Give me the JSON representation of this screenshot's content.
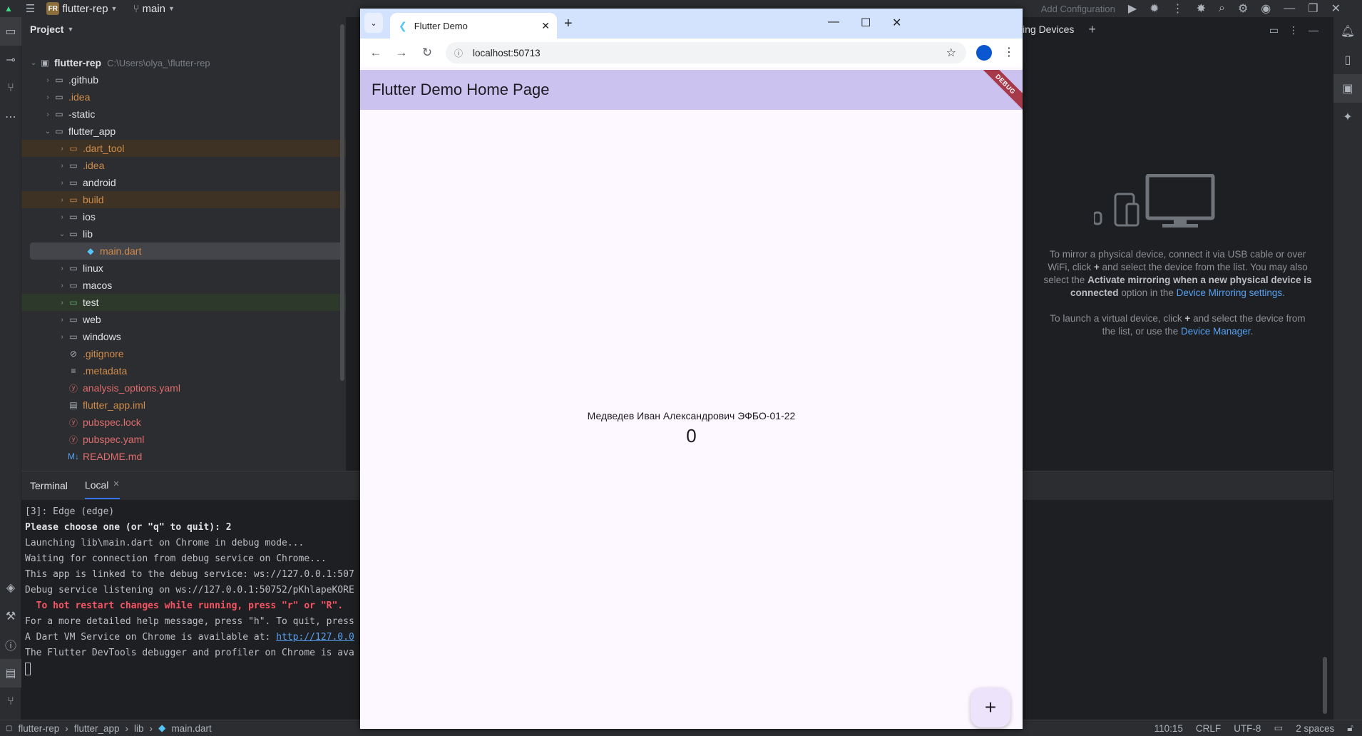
{
  "ide": {
    "project_badge": "FR",
    "project_name": "flutter-rep",
    "branch": "main",
    "run_config": "Add Configuration",
    "project_panel_title": "Project",
    "tree": {
      "root_name": "flutter-rep",
      "root_path": "C:\\Users\\olya_\\flutter-rep",
      "items": [
        ".github",
        ".idea",
        "-static",
        "flutter_app",
        ".dart_tool",
        ".idea",
        "android",
        "build",
        "ios",
        "lib",
        "main.dart",
        "linux",
        "macos",
        "test",
        "web",
        "windows",
        ".gitignore",
        ".metadata",
        "analysis_options.yaml",
        "flutter_app.iml",
        "pubspec.lock",
        "pubspec.yaml",
        "README.md"
      ]
    },
    "devices": {
      "title": "ing Devices",
      "mirror_text_1": "To mirror a physical device, connect it via USB cable or over",
      "mirror_text_2a": "WiFi, click",
      "mirror_text_2b": "and select the device from the list. You may also",
      "mirror_text_3a": "select the",
      "mirror_text_3b": "Activate mirroring when a new physical device is",
      "mirror_text_4a": "connected",
      "mirror_text_4b": "option in the",
      "mirror_link": "Device Mirroring settings",
      "virtual_text_1a": "To launch a virtual device, click",
      "virtual_text_1b": "and select the device from",
      "virtual_text_2": "the list, or use the",
      "virtual_link": "Device Manager"
    },
    "terminal": {
      "tab_terminal": "Terminal",
      "tab_local": "Local",
      "lines": [
        "[3]: Edge (edge)",
        "Please choose one (or \"q\" to quit): 2",
        "Launching lib\\main.dart on Chrome in debug mode...",
        "Waiting for connection from debug service on Chrome...",
        "This app is linked to the debug service: ws://127.0.0.1:507",
        "Debug service listening on ws://127.0.0.1:50752/pKhlapeKORE",
        "",
        "  To hot restart changes while running, press \"r\" or \"R\".",
        "For a more detailed help message, press \"h\". To quit, press",
        "",
        "A Dart VM Service on Chrome is available at: ",
        "The Flutter DevTools debugger and profiler on Chrome is ava"
      ],
      "vm_link": "http://127.0.0"
    },
    "status": {
      "crumbs": [
        "flutter-rep",
        "flutter_app",
        "lib",
        "main.dart"
      ],
      "position": "110:15",
      "line_sep": "CRLF",
      "encoding": "UTF-8",
      "indent": "2 spaces"
    }
  },
  "browser": {
    "tab_title": "Flutter Demo",
    "url": "localhost:50713"
  },
  "app": {
    "title": "Flutter Demo Home Page",
    "debug_banner": "DEBUG",
    "student": "Медведев Иван Александрович ЭФБО-01-22",
    "counter": "0",
    "fab_icon": "+"
  },
  "colors": {
    "app_bar": "#ccc2f0",
    "app_bg": "#fdf7ff",
    "ide_bg": "#1e1f22",
    "link": "#57a0f0"
  }
}
